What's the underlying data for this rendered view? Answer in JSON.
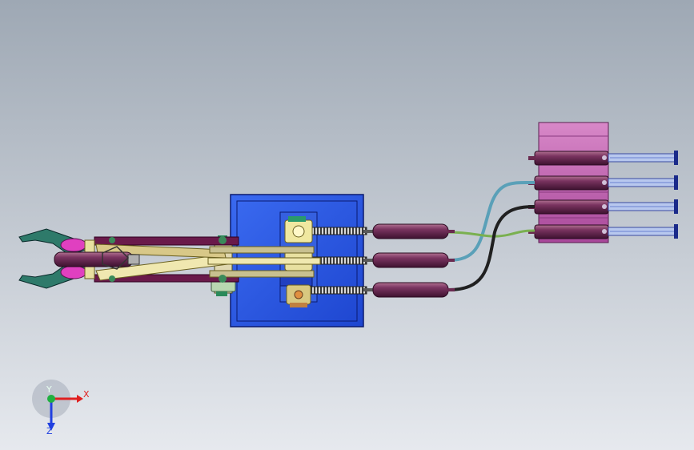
{
  "viewport": {
    "background_top": "#9ea8b4",
    "background_bottom": "#e6e9ee"
  },
  "triad": {
    "x_label": "X",
    "y_label": "Y",
    "z_label": "Z",
    "x_color": "#e02020",
    "y_color": "#20b040",
    "z_color": "#2040e0"
  },
  "colors": {
    "gearbox": "#2a55e6",
    "cylinder": "#6e2a52",
    "syringe_block": "#c060b0",
    "gripper_jaw": "#2e7a6a",
    "gripper_pad": "#e040c0",
    "link_bar": "#e8e0a0",
    "tube_blue": "#5aa0b8",
    "tube_green": "#7ab050",
    "tube_black": "#202020",
    "rack": "#404040",
    "syringe_glass": "#b8c8ee"
  }
}
